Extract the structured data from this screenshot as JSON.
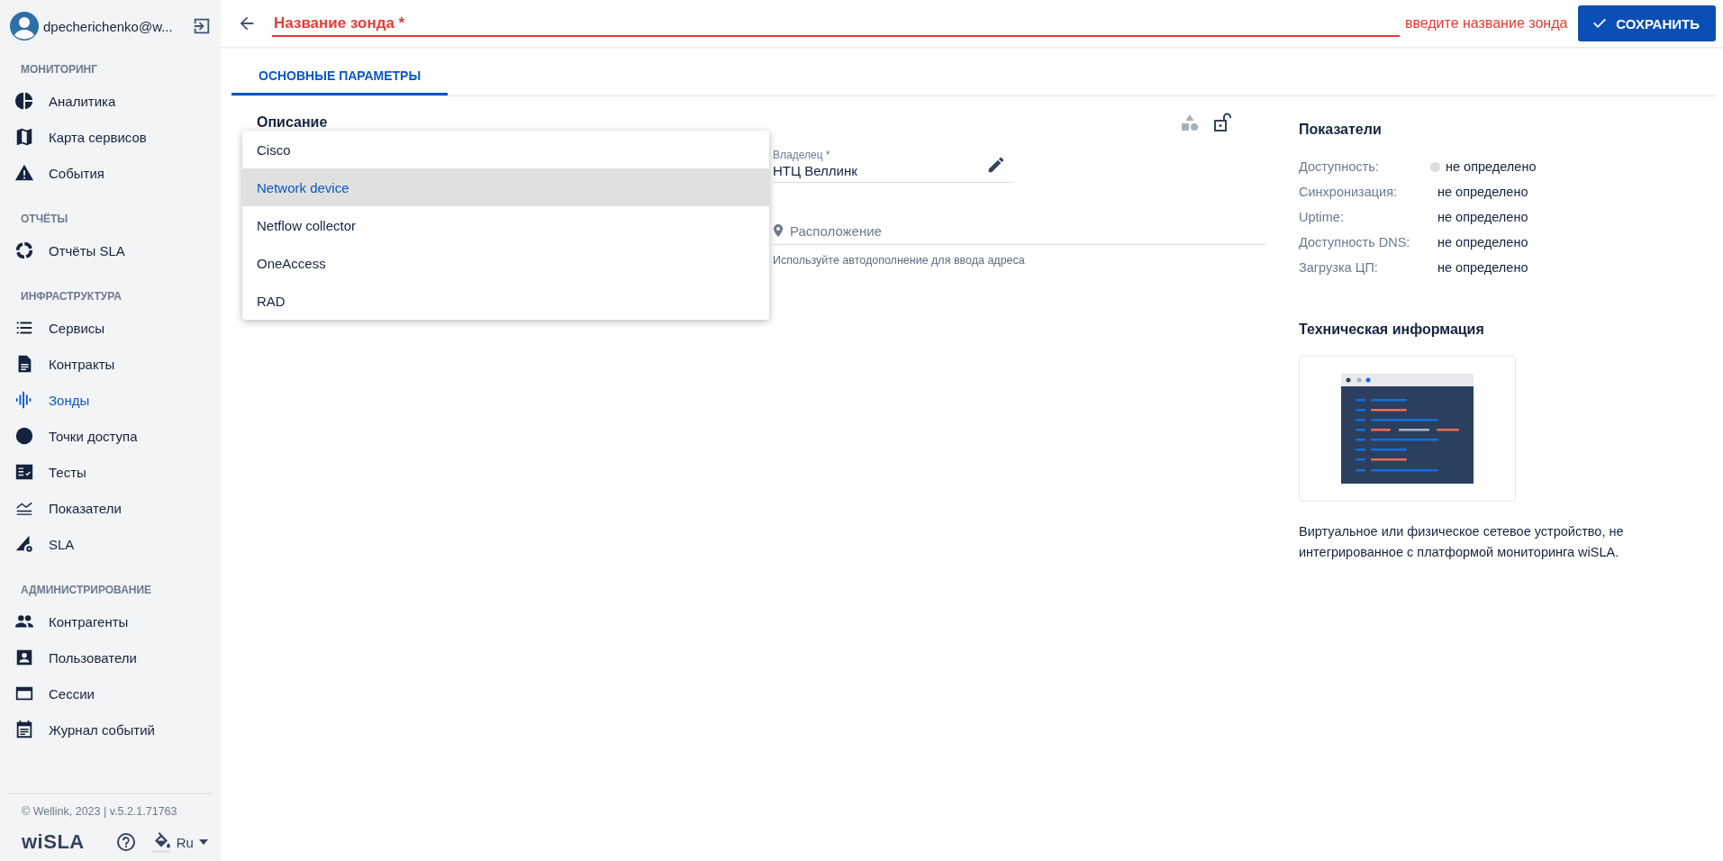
{
  "sidebar": {
    "user": {
      "name": "dpecherichenko@w..."
    },
    "sections": [
      {
        "title": "МОНИТОРИНГ",
        "items": [
          {
            "label": "Аналитика",
            "selected": false
          },
          {
            "label": "Карта сервисов",
            "selected": false
          },
          {
            "label": "События",
            "selected": false
          }
        ]
      },
      {
        "title": "ОТЧЁТЫ",
        "items": [
          {
            "label": "Отчёты SLA",
            "selected": false
          }
        ]
      },
      {
        "title": "ИНФРАСТРУКТУРА",
        "items": [
          {
            "label": "Сервисы",
            "selected": false
          },
          {
            "label": "Контракты",
            "selected": false
          },
          {
            "label": "Зонды",
            "selected": true
          },
          {
            "label": "Точки доступа",
            "selected": false
          },
          {
            "label": "Тесты",
            "selected": false
          },
          {
            "label": "Показатели",
            "selected": false
          },
          {
            "label": "SLA",
            "selected": false
          }
        ]
      },
      {
        "title": "АДМИНИСТРИРОВАНИЕ",
        "items": [
          {
            "label": "Контрагенты",
            "selected": false
          },
          {
            "label": "Пользователи",
            "selected": false
          },
          {
            "label": "Сессии",
            "selected": false
          },
          {
            "label": "Журнал событий",
            "selected": false
          }
        ]
      }
    ],
    "footer": {
      "copyright": "© Wellink, 2023 | v.5.2.1.71763",
      "logo": "wiSLA",
      "language": "Ru"
    }
  },
  "header": {
    "title_field": {
      "placeholder": "Название зонда *",
      "error": "введите название зонда"
    },
    "save_button": "СОХРАНИТЬ"
  },
  "tabs": [
    {
      "label": "ОСНОВНЫЕ ПАРАМЕТРЫ",
      "selected": true
    }
  ],
  "form": {
    "section_title": "Описание",
    "owner": {
      "label": "Владелец *",
      "value": "НТЦ Веллинк"
    },
    "location": {
      "placeholder": "Расположение",
      "hint": "Используйте автодополнение для ввода адреса"
    },
    "dropdown": [
      {
        "label": "Cisco",
        "selected": false
      },
      {
        "label": "Network device",
        "selected": true
      },
      {
        "label": "Netflow collector",
        "selected": false
      },
      {
        "label": "OneAccess",
        "selected": false
      },
      {
        "label": "RAD",
        "selected": false
      }
    ]
  },
  "metrics": {
    "title": "Показатели",
    "rows": [
      {
        "label": "Доступность:",
        "value": "не определено",
        "color": "#dcdcdc"
      },
      {
        "label": "Синхронизация:",
        "value": "не определено"
      },
      {
        "label": "Uptime:",
        "value": "не определено"
      },
      {
        "label": "Доступность DNS:",
        "value": "не определено"
      },
      {
        "label": "Загрузка ЦП:",
        "value": "не определено"
      }
    ]
  },
  "tech_info": {
    "title": "Техническая информация",
    "description": "Виртуальное или физическое сетевое устройство, не интегрированное с платформой мониторинга wiSLA."
  }
}
